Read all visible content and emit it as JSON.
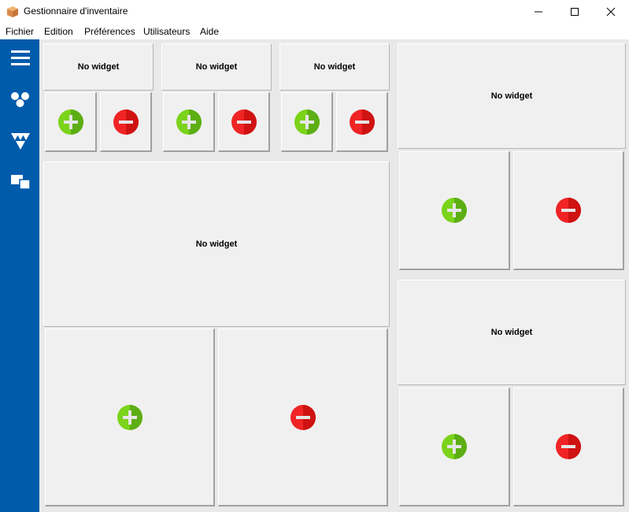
{
  "window": {
    "title": "Gestionnaire d'inventaire",
    "icon": "package-icon"
  },
  "menu": {
    "items": [
      "Fichier",
      "Edition",
      "Préférences",
      "Utilisateurs",
      "Aide"
    ]
  },
  "sidebar": {
    "icons": [
      "hamburger-menu-icon",
      "cluster-icon",
      "triangles-icon",
      "windows-icon"
    ],
    "color": "#005bab"
  },
  "panels": {
    "empty_label": "No widget"
  },
  "colors": {
    "add": "#6cc417",
    "remove": "#e81c1c"
  }
}
